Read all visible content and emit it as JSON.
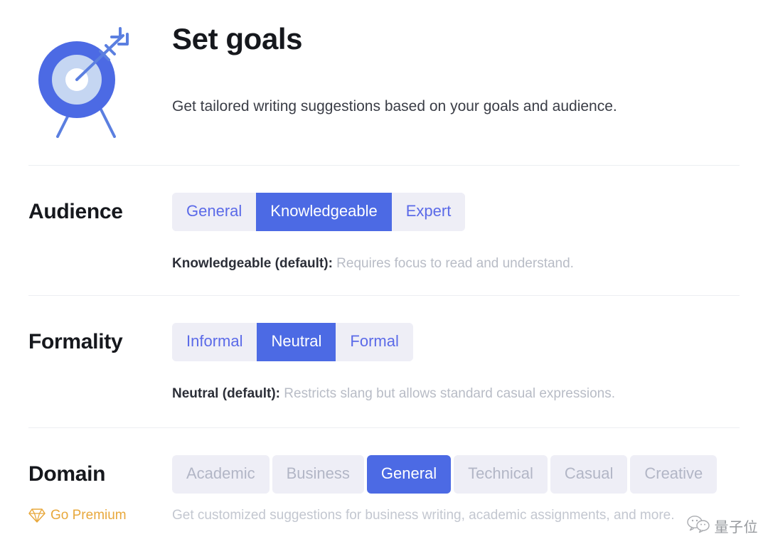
{
  "header": {
    "icon": "target-with-arrow-icon",
    "title": "Set goals",
    "subtitle": "Get tailored writing suggestions based on your goals and audience."
  },
  "settings": [
    {
      "key": "audience",
      "label": "Audience",
      "options": [
        {
          "label": "General",
          "selected": false,
          "disabled": false
        },
        {
          "label": "Knowledgeable",
          "selected": true,
          "disabled": false
        },
        {
          "label": "Expert",
          "selected": false,
          "disabled": false
        }
      ],
      "hint_strong": "Knowledgeable (default):",
      "hint_text": " Requires focus to read and understand."
    },
    {
      "key": "formality",
      "label": "Formality",
      "options": [
        {
          "label": "Informal",
          "selected": false,
          "disabled": false
        },
        {
          "label": "Neutral",
          "selected": true,
          "disabled": false
        },
        {
          "label": "Formal",
          "selected": false,
          "disabled": false
        }
      ],
      "hint_strong": "Neutral (default):",
      "hint_text": " Restricts slang but allows standard casual expressions."
    },
    {
      "key": "domain",
      "label": "Domain",
      "options": [
        {
          "label": "Academic",
          "selected": false,
          "disabled": true
        },
        {
          "label": "Business",
          "selected": false,
          "disabled": true
        },
        {
          "label": "General",
          "selected": true,
          "disabled": false
        },
        {
          "label": "Technical",
          "selected": false,
          "disabled": true
        },
        {
          "label": "Casual",
          "selected": false,
          "disabled": true
        },
        {
          "label": "Creative",
          "selected": false,
          "disabled": true
        }
      ],
      "hint_strong": "",
      "hint_text": ""
    }
  ],
  "premium": {
    "icon": "diamond-gem-icon",
    "label": "Go Premium",
    "hint": "Get customized suggestions for business writing, academic assignments, and more."
  },
  "watermark": {
    "icon": "wechat-icon",
    "text": "量子位"
  },
  "colors": {
    "accent_blue": "#4c6ae4",
    "segment_bg": "#eeeef6",
    "segment_text": "#5b6ae8",
    "disabled_text": "#b2b6c6",
    "premium_gold": "#e8a83c",
    "hint_gray": "#b8bcc6",
    "divider": "#eceef2",
    "title_dark": "#16181d"
  }
}
